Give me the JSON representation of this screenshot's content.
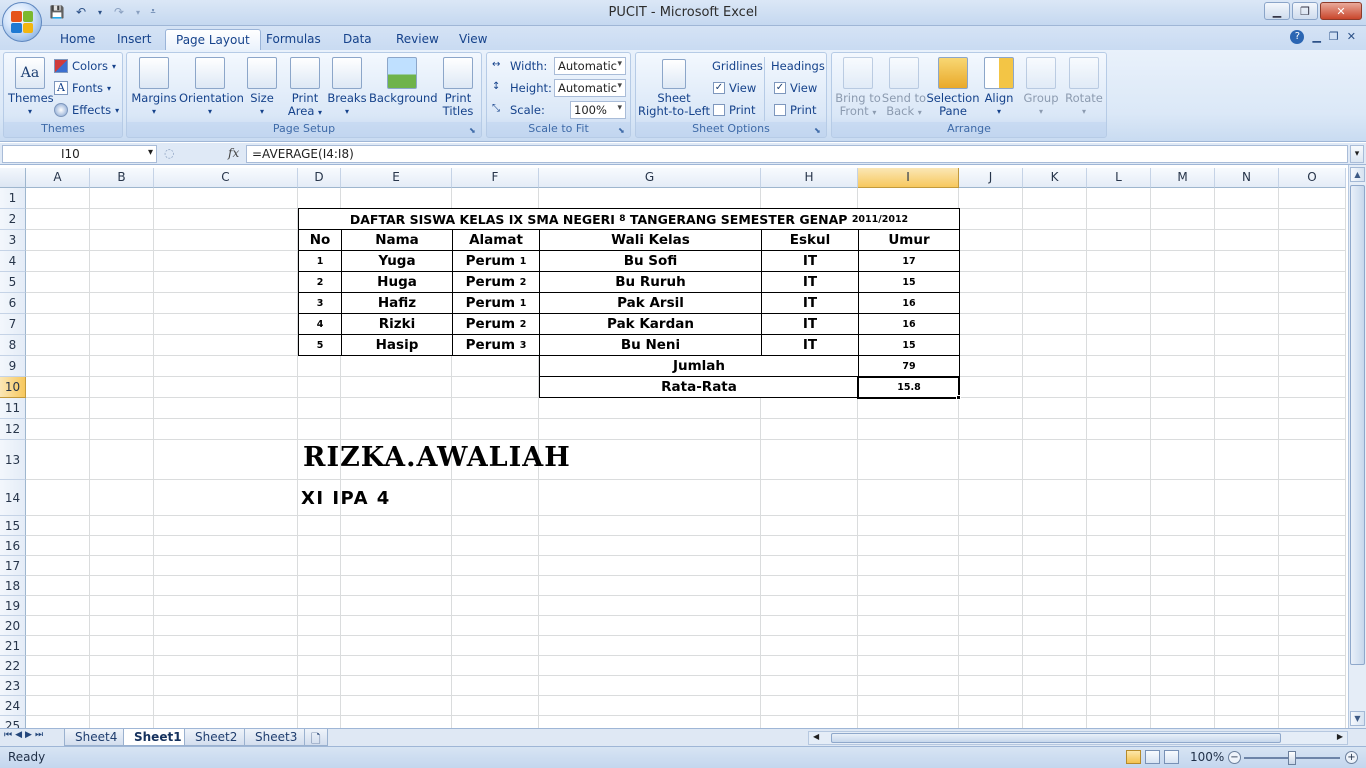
{
  "window": {
    "title": "PUCIT - Microsoft Excel"
  },
  "ribbon": {
    "tabs": [
      "Home",
      "Insert",
      "Page Layout",
      "Formulas",
      "Data",
      "Review",
      "View"
    ],
    "active_tab": "Page Layout",
    "themes_group": {
      "label": "Themes",
      "themes_btn": "Themes",
      "colors": "Colors",
      "fonts": "Fonts",
      "effects": "Effects"
    },
    "page_setup": {
      "label": "Page Setup",
      "margins": "Margins",
      "orientation": "Orientation",
      "size": "Size",
      "print_area_1": "Print",
      "print_area_2": "Area",
      "breaks": "Breaks",
      "background": "Background",
      "print_titles_1": "Print",
      "print_titles_2": "Titles"
    },
    "scale_to_fit": {
      "label": "Scale to Fit",
      "width_label": "Width:",
      "width_value": "Automatic",
      "height_label": "Height:",
      "height_value": "Automatic",
      "scale_label": "Scale:",
      "scale_value": "100%"
    },
    "sheet_options": {
      "label": "Sheet Options",
      "rtl_1": "Sheet",
      "rtl_2": "Right-to-Left",
      "gridlines": "Gridlines",
      "headings": "Headings",
      "view": "View",
      "print": "Print",
      "gridlines_view_checked": true,
      "gridlines_print_checked": false,
      "headings_view_checked": true,
      "headings_print_checked": false
    },
    "arrange": {
      "label": "Arrange",
      "bring_front_1": "Bring to",
      "bring_front_2": "Front",
      "send_back_1": "Send to",
      "send_back_2": "Back",
      "selection_pane_1": "Selection",
      "selection_pane_2": "Pane",
      "align": "Align",
      "group": "Group",
      "rotate": "Rotate"
    }
  },
  "formula_bar": {
    "name_box": "I10",
    "fx": "fx",
    "formula": "=AVERAGE(I4:I8)"
  },
  "columns": [
    "A",
    "B",
    "C",
    "D",
    "E",
    "F",
    "G",
    "H",
    "I",
    "J",
    "K",
    "L",
    "M",
    "N",
    "O"
  ],
  "rows": [
    "1",
    "2",
    "3",
    "4",
    "5",
    "6",
    "7",
    "8",
    "9",
    "10",
    "11",
    "12",
    "13",
    "14",
    "15",
    "16",
    "17",
    "18",
    "19",
    "20",
    "21",
    "22",
    "23",
    "24",
    "25"
  ],
  "table": {
    "title_main": "DAFTAR SISWA KELAS IX SMA NEGERI",
    "title_num": "8",
    "title_mid": "TANGERANG SEMESTER GENAP",
    "title_year": "2011/2012",
    "headers": [
      "No",
      "Nama",
      "Alamat",
      "Wali Kelas",
      "Eskul",
      "Umur"
    ],
    "rows": [
      {
        "no": "1",
        "nama": "Yuga",
        "alamat": "Perum",
        "alamat_n": "1",
        "wali": "Bu Sofi",
        "eskul": "IT",
        "umur": "17"
      },
      {
        "no": "2",
        "nama": "Huga",
        "alamat": "Perum",
        "alamat_n": "2",
        "wali": "Bu Ruruh",
        "eskul": "IT",
        "umur": "15"
      },
      {
        "no": "3",
        "nama": "Hafiz",
        "alamat": "Perum",
        "alamat_n": "1",
        "wali": "Pak Arsil",
        "eskul": "IT",
        "umur": "16"
      },
      {
        "no": "4",
        "nama": "Rizki",
        "alamat": "Perum",
        "alamat_n": "2",
        "wali": "Pak Kardan",
        "eskul": "IT",
        "umur": "16"
      },
      {
        "no": "5",
        "nama": "Hasip",
        "alamat": "Perum",
        "alamat_n": "3",
        "wali": "Bu Neni",
        "eskul": "IT",
        "umur": "15"
      }
    ],
    "jumlah_label": "Jumlah",
    "jumlah_value": "79",
    "rata_label": "Rata-Rata",
    "rata_value": "15.8"
  },
  "author": {
    "name": "RIZKA.AWALIAH",
    "class": "XI IPA 4"
  },
  "sheets": [
    "Sheet4",
    "Sheet1",
    "Sheet2",
    "Sheet3"
  ],
  "active_sheet": "Sheet1",
  "status": {
    "ready": "Ready",
    "zoom": "100%"
  },
  "colors": {
    "ribbon_text": "#15428b",
    "selected_header": "#f7c85e",
    "grid_line": "#dadcdd"
  }
}
